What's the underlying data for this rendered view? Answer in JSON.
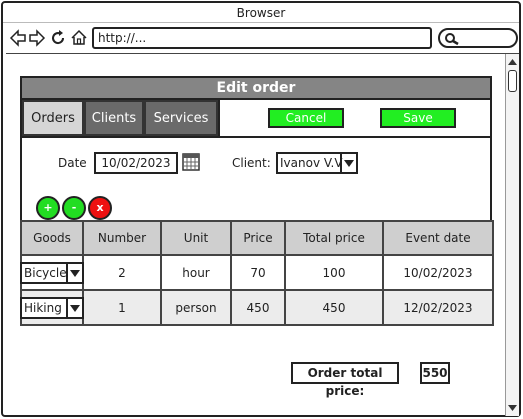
{
  "browser": {
    "title": "Browser",
    "url": "http://...",
    "icons": [
      "arrow-left-icon",
      "arrow-right-icon",
      "reload-icon",
      "home-icon",
      "search-icon"
    ]
  },
  "panel": {
    "title": "Edit order"
  },
  "tabs": [
    {
      "label": "Orders",
      "active": true
    },
    {
      "label": "Clients",
      "active": false
    },
    {
      "label": "Services",
      "active": false
    }
  ],
  "actions": {
    "cancel_label": "Cancel",
    "save_label": "Save"
  },
  "form": {
    "date_label": "Date",
    "date_value": "10/02/2023",
    "client_label": "Client:",
    "client_value": "Ivanov V.V"
  },
  "row_buttons": {
    "add": "+",
    "remove": "-",
    "delete": "x"
  },
  "table": {
    "headers": [
      "Goods",
      "Number",
      "Unit",
      "Price",
      "Total price",
      "Event date"
    ],
    "rows": [
      {
        "goods": "Bicycle",
        "number": "2",
        "unit": "hour",
        "price": "70",
        "total": "100",
        "date": "10/02/2023"
      },
      {
        "goods": "Hiking",
        "number": "1",
        "unit": "person",
        "price": "450",
        "total": "450",
        "date": "12/02/2023"
      }
    ]
  },
  "summary": {
    "label": "Order total price:",
    "value": "550"
  },
  "colors": {
    "header": "#858585",
    "active_tab": "#d6d6d6",
    "inactive_tab": "#6a6a6a",
    "green": "#22ee22",
    "red": "#ee1111"
  }
}
